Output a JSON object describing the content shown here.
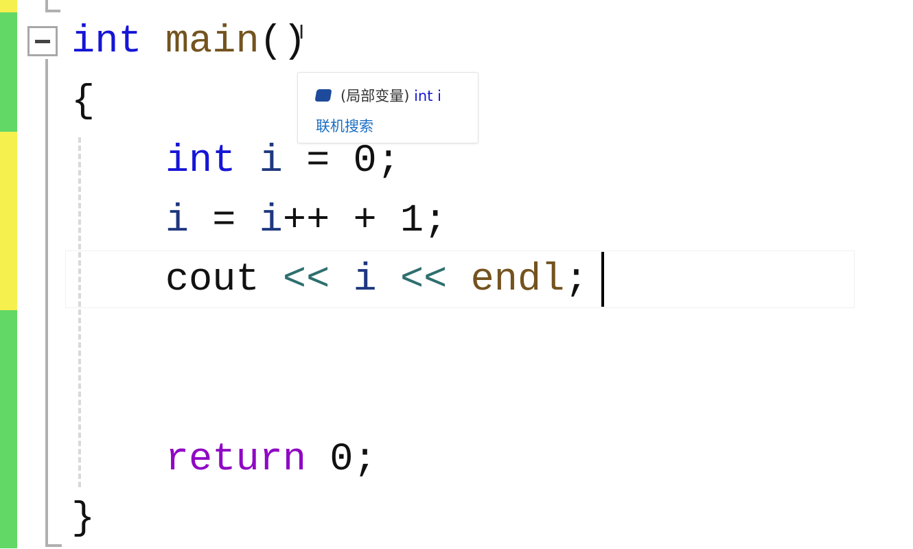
{
  "editor": {
    "lines": [
      {
        "tokens": [
          "int",
          " ",
          "main",
          "()"
        ]
      },
      {
        "tokens": [
          "{"
        ]
      },
      {
        "tokens": [
          "    ",
          "int",
          " ",
          "i",
          " = 0;"
        ]
      },
      {
        "tokens": [
          "    ",
          "i",
          " = ",
          "i",
          "++ + 1;"
        ]
      },
      {
        "tokens": [
          "    ",
          "cout",
          " ",
          "<<",
          " ",
          "i",
          " ",
          "<<",
          " ",
          "endl",
          ";"
        ]
      },
      {
        "tokens": [
          "    ",
          "return",
          " 0;"
        ]
      },
      {
        "tokens": [
          "}"
        ]
      }
    ],
    "colors": {
      "keyword": "#1515d6",
      "function": "#74531f",
      "operator": "#2f6f6f",
      "control": "#8f08c4",
      "change_saved": "#62d866",
      "change_unsaved": "#f6f04f"
    }
  },
  "tooltip": {
    "icon": "local-variable-cube-icon",
    "kind": "(局部变量)",
    "signature": "int i",
    "link": "联机搜索"
  }
}
